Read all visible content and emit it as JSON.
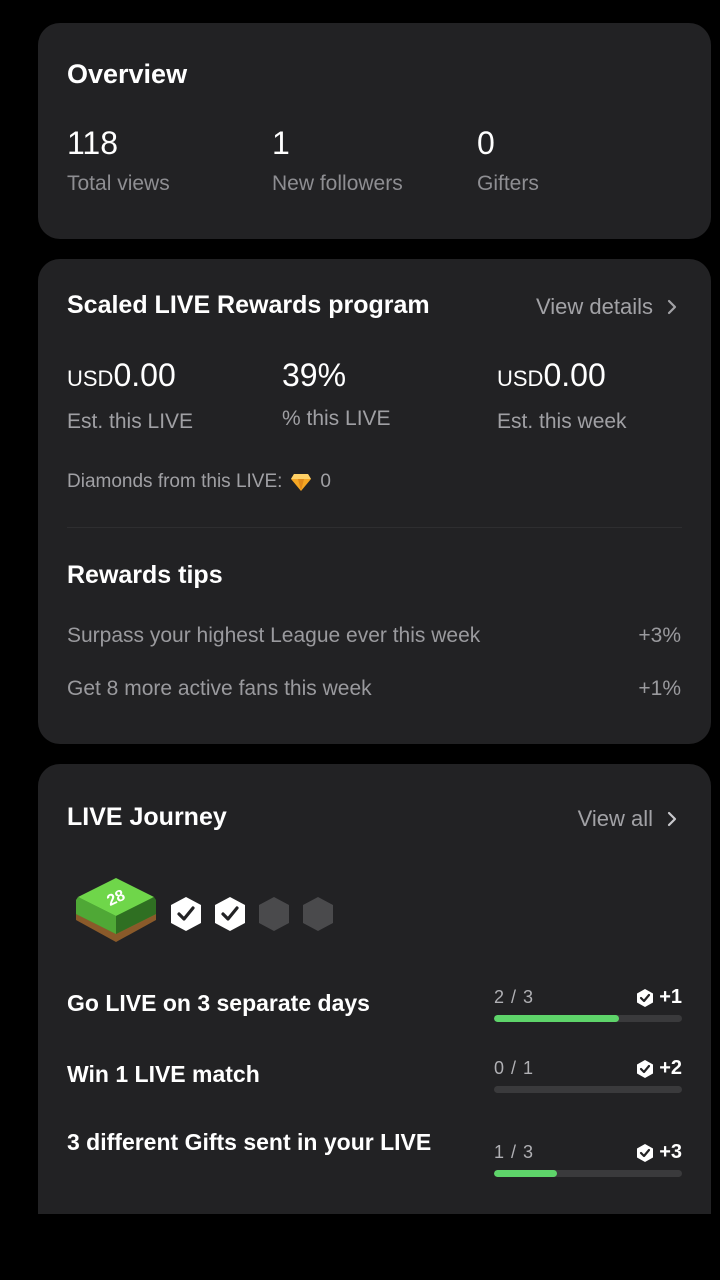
{
  "overview": {
    "title": "Overview",
    "stats": [
      {
        "value": "118",
        "label": "Total views"
      },
      {
        "value": "1",
        "label": "New followers"
      },
      {
        "value": "0",
        "label": "Gifters"
      }
    ]
  },
  "rewards": {
    "title": "Scaled LIVE Rewards program",
    "view_details": "View details",
    "metrics": [
      {
        "currency": "USD",
        "value": "0.00",
        "label": "Est. this LIVE"
      },
      {
        "currency": "",
        "value": "39%",
        "label": "% this LIVE"
      },
      {
        "currency": "USD",
        "value": "0.00",
        "label": "Est. this week"
      }
    ],
    "diamonds_label": "Diamonds from this LIVE:",
    "diamonds_value": "0",
    "tips_title": "Rewards tips",
    "tips": [
      {
        "text": "Surpass your highest League ever this week",
        "value": "+3%"
      },
      {
        "text": "Get 8 more active fans this week",
        "value": "+1%"
      }
    ]
  },
  "journey": {
    "title": "LIVE Journey",
    "view_all": "View all",
    "level_badge": "28",
    "milestones": [
      "completed",
      "completed",
      "locked",
      "locked"
    ],
    "tasks": [
      {
        "label": "Go LIVE on 3 separate days",
        "count": "2 / 3",
        "reward": "+1",
        "progress": 0.667
      },
      {
        "label": "Win 1 LIVE match",
        "count": "0 / 1",
        "reward": "+2",
        "progress": 0
      },
      {
        "label": "3 different Gifts sent in your LIVE",
        "count": "1 / 3",
        "reward": "+3",
        "progress": 0.333
      }
    ]
  },
  "colors": {
    "background": "#000000",
    "card": "#222224",
    "progress": "#5ed46a",
    "diamond": "#f5a623"
  },
  "icons": [
    "chevron-right-icon",
    "diamond-icon",
    "level-badge-icon",
    "check-hexagon-icon",
    "reward-check-icon"
  ]
}
